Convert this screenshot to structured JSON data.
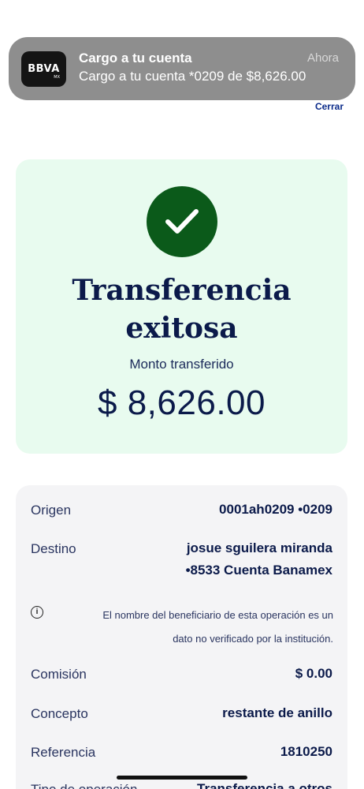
{
  "notification": {
    "logo_text": "BBVA",
    "logo_sub": "MX",
    "title": "Cargo a tu cuenta",
    "body": "Cargo a tu cuenta *0209 de $8,626.00",
    "time": "Ahora",
    "close_label": "Cerrar"
  },
  "success": {
    "title_line1": "Transferencia",
    "title_line2": "exitosa",
    "amount_label": "Monto transferido",
    "amount": "$ 8,626.00",
    "accent_color": "#0b5a1a"
  },
  "details": {
    "origen_label": "Origen",
    "origen_value": "0001ah0209 •0209",
    "destino_label": "Destino",
    "destino_value_line1": "josue sguilera miranda",
    "destino_value_line2": "•8533 Cuenta Banamex",
    "info_line1": "El nombre del beneficiario de esta operación es un",
    "info_line2": "dato no verificado por la institución.",
    "comision_label": "Comisión",
    "comision_value": "$ 0.00",
    "concepto_label": "Concepto",
    "concepto_value": "restante de anillo",
    "referencia_label": "Referencia",
    "referencia_value": "1810250",
    "tipo_label": "Tipo de operación",
    "tipo_value": "Transferencia a otros"
  }
}
